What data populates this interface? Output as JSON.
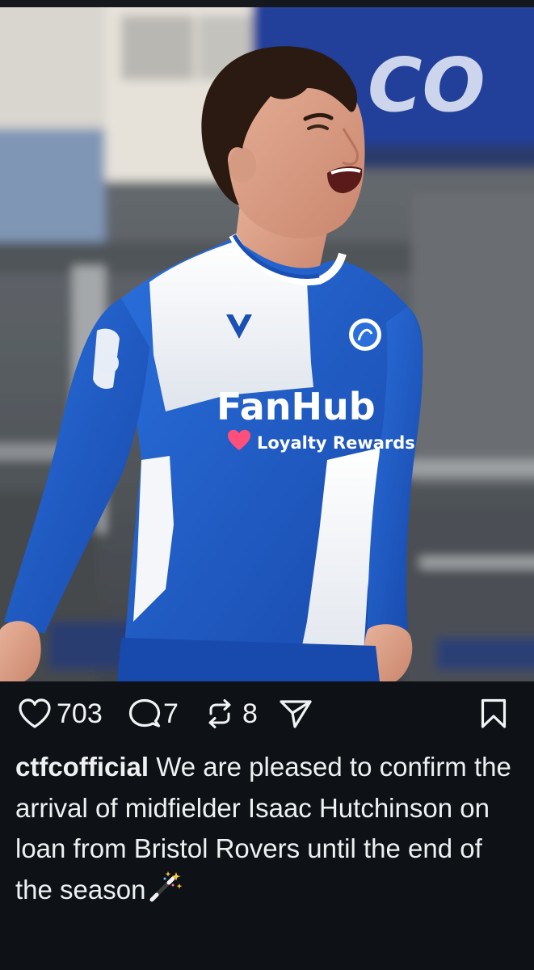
{
  "post": {
    "photo_alt": "Footballer in blue and white quartered kit celebrating",
    "sponsor": {
      "brand": "FanHub",
      "tagline": "Loyalty Rewards"
    },
    "stats": {
      "likes": "703",
      "comments": "7",
      "reposts": "8"
    },
    "caption": {
      "username": "ctfcofficial",
      "text": "We are pleased to confirm the arrival of midfielder Isaac Hutchinson on loan from Bristol Rovers until the end of the season"
    },
    "icons": {
      "like": "heart-icon",
      "comment": "comment-bubble-icon",
      "repost": "repost-icon",
      "share": "send-icon",
      "save": "bookmark-icon",
      "emoji": "magic-wand-emoji"
    }
  },
  "colors": {
    "background": "#0e1216",
    "text": "#f2f3f5",
    "kit_blue": "#1a5bc4",
    "kit_white": "#f4f6fa",
    "stadium_banner": "#23409a"
  }
}
